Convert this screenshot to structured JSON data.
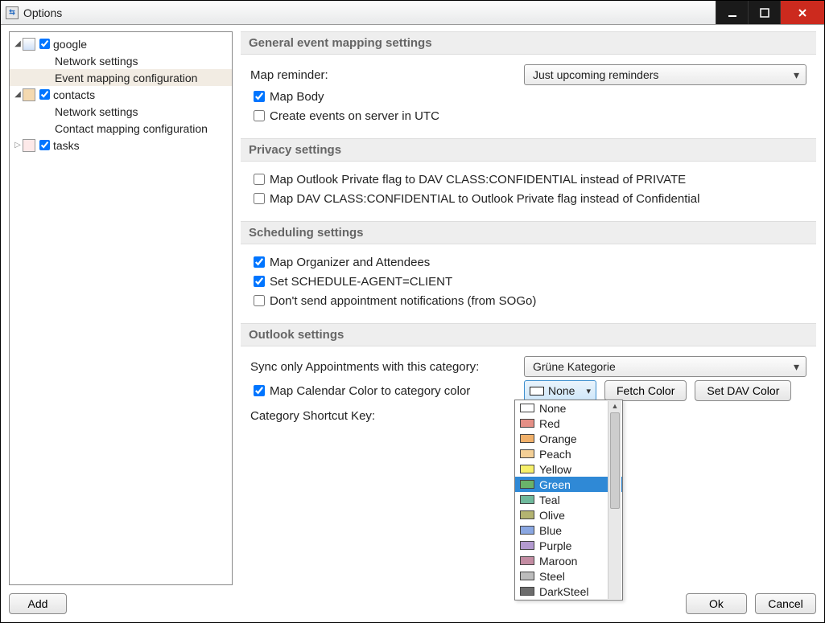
{
  "window": {
    "title": "Options"
  },
  "tree": {
    "google": {
      "label": "google",
      "net": "Network settings",
      "evt": "Event mapping configuration"
    },
    "contacts": {
      "label": "contacts",
      "net": "Network settings",
      "map": "Contact mapping configuration"
    },
    "tasks": {
      "label": "tasks"
    }
  },
  "sections": {
    "general": {
      "title": "General event mapping settings",
      "mapReminderLabel": "Map reminder:",
      "mapReminderValue": "Just upcoming reminders",
      "mapBody": "Map Body",
      "utc": "Create events on server in UTC"
    },
    "privacy": {
      "title": "Privacy settings",
      "opt1": "Map Outlook Private flag to DAV CLASS:CONFIDENTIAL instead of PRIVATE",
      "opt2": "Map DAV CLASS:CONFIDENTIAL to Outlook Private flag instead of Confidential"
    },
    "scheduling": {
      "title": "Scheduling settings",
      "opt1": "Map Organizer and Attendees",
      "opt2": "Set SCHEDULE-AGENT=CLIENT",
      "opt3": "Don't send appointment notifications (from SOGo)"
    },
    "outlook": {
      "title": "Outlook settings",
      "syncLabel": "Sync only Appointments with this category:",
      "syncValue": "Grüne Kategorie",
      "mapColor": "Map Calendar Color to category color",
      "shortcut": "Category Shortcut Key:",
      "noneLabel": "None",
      "fetch": "Fetch Color",
      "setDav": "Set DAV Color"
    }
  },
  "colors": [
    {
      "name": "None",
      "hex": "#ffffff"
    },
    {
      "name": "Red",
      "hex": "#e48f86"
    },
    {
      "name": "Orange",
      "hex": "#f0b06a"
    },
    {
      "name": "Peach",
      "hex": "#f3cf96"
    },
    {
      "name": "Yellow",
      "hex": "#f7f06a"
    },
    {
      "name": "Green",
      "hex": "#6ab36a",
      "selected": true
    },
    {
      "name": "Teal",
      "hex": "#6fb99c"
    },
    {
      "name": "Olive",
      "hex": "#b3b371"
    },
    {
      "name": "Blue",
      "hex": "#8aa7e2"
    },
    {
      "name": "Purple",
      "hex": "#b39ad0"
    },
    {
      "name": "Maroon",
      "hex": "#c38ca2"
    },
    {
      "name": "Steel",
      "hex": "#bcbcbc"
    },
    {
      "name": "DarkSteel",
      "hex": "#6c6c6c"
    }
  ],
  "buttons": {
    "add": "Add",
    "ok": "Ok",
    "cancel": "Cancel"
  }
}
